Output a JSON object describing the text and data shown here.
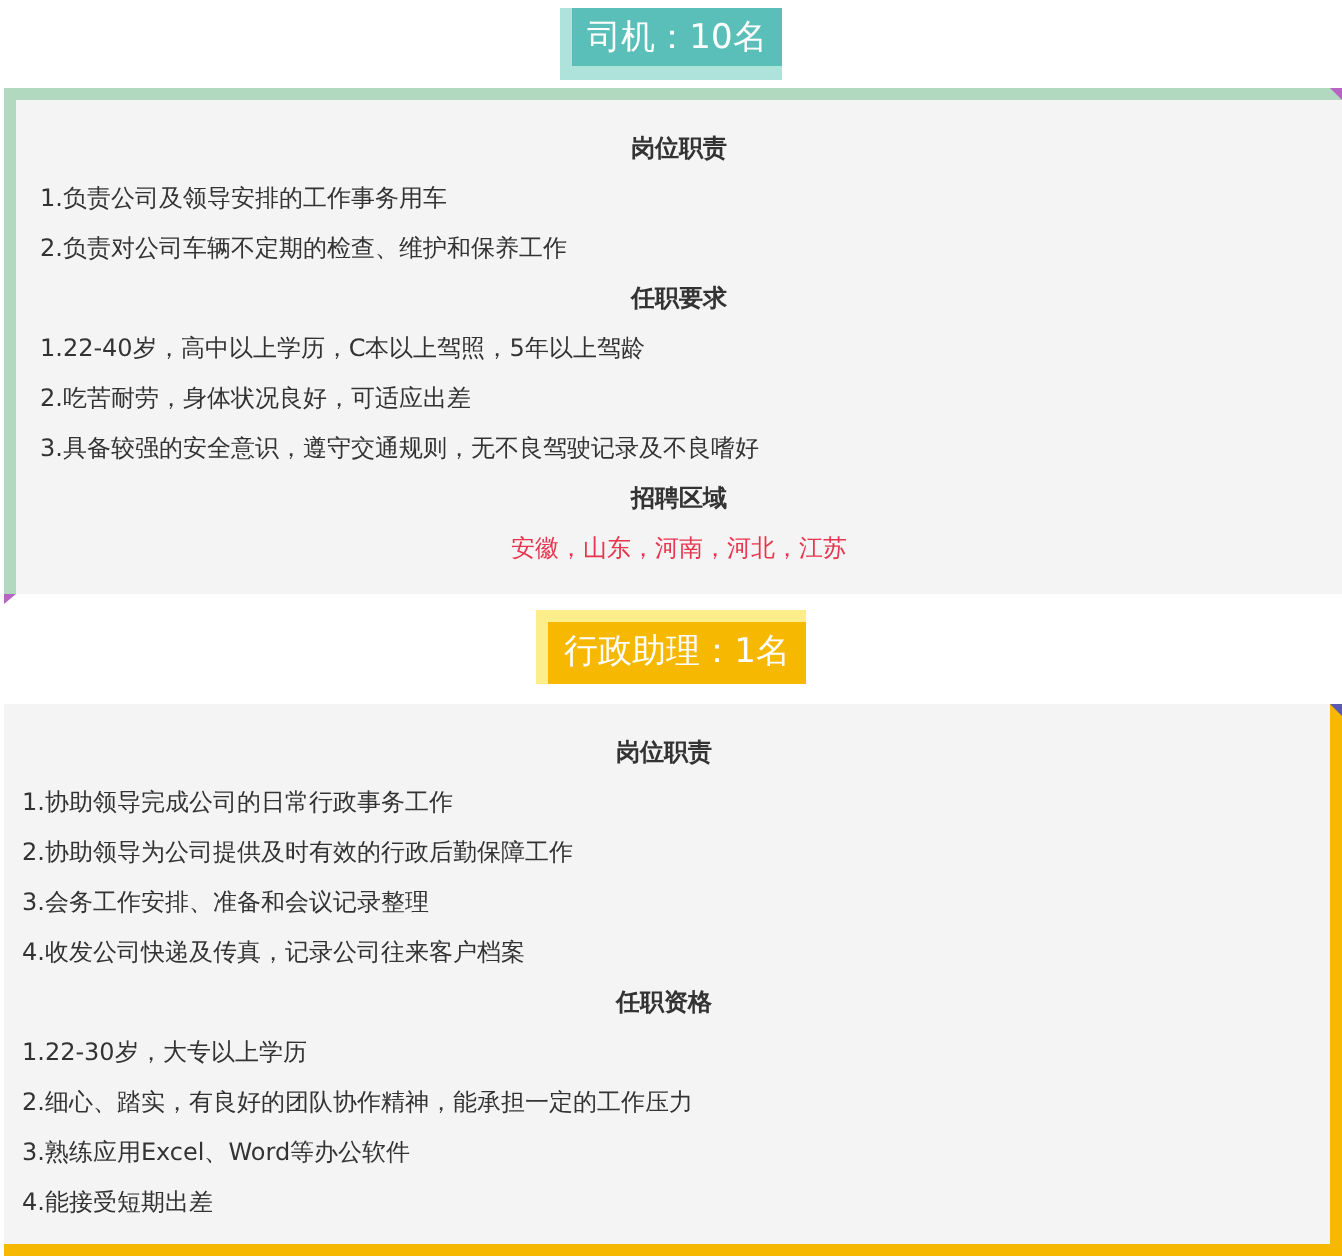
{
  "sections": [
    {
      "title": "司机：10名",
      "kind": "teal",
      "blocks": [
        {
          "kind": "heading",
          "text": "岗位职责"
        },
        {
          "kind": "item",
          "text": "1.负责公司及领导安排的工作事务用车"
        },
        {
          "kind": "item",
          "text": "2.负责对公司车辆不定期的检查、维护和保养工作"
        },
        {
          "kind": "heading",
          "text": "任职要求"
        },
        {
          "kind": "item",
          "text": "1.22-40岁，高中以上学历，C本以上驾照，5年以上驾龄"
        },
        {
          "kind": "item",
          "text": "2.吃苦耐劳，身体状况良好，可适应出差"
        },
        {
          "kind": "item",
          "text": "3.具备较强的安全意识，遵守交通规则，无不良驾驶记录及不良嗜好"
        },
        {
          "kind": "heading",
          "text": "招聘区域"
        },
        {
          "kind": "highlight",
          "text": "安徽，山东，河南，河北，江苏"
        }
      ]
    },
    {
      "title": "行政助理：1名",
      "kind": "gold",
      "blocks": [
        {
          "kind": "heading",
          "text": "岗位职责"
        },
        {
          "kind": "item",
          "text": "1.协助领导完成公司的日常行政事务工作"
        },
        {
          "kind": "item",
          "text": "2.协助领导为公司提供及时有效的行政后勤保障工作"
        },
        {
          "kind": "item",
          "text": "3.会务工作安排、准备和会议记录整理"
        },
        {
          "kind": "item",
          "text": "4.收发公司快递及传真，记录公司往来客户档案"
        },
        {
          "kind": "heading",
          "text": "任职资格"
        },
        {
          "kind": "item",
          "text": "1.22-30岁，大专以上学历"
        },
        {
          "kind": "item",
          "text": "2.细心、踏实，有良好的团队协作精神，能承担一定的工作压力"
        },
        {
          "kind": "item",
          "text": "3.熟练应用Excel、Word等办公软件"
        },
        {
          "kind": "item",
          "text": "4.能接受短期出差"
        }
      ]
    }
  ]
}
